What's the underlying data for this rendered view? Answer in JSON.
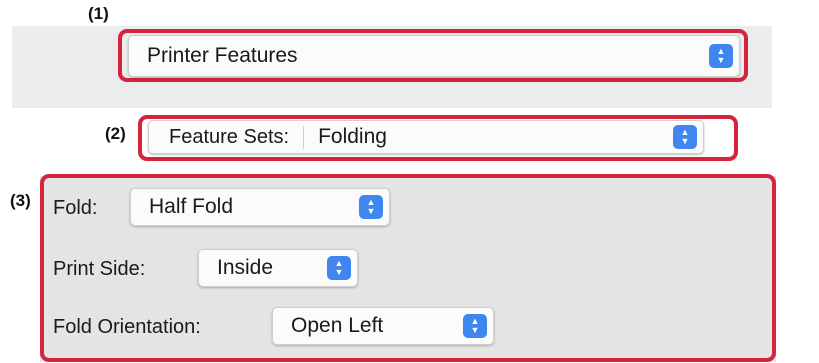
{
  "callouts": {
    "c1": "(1)",
    "c2": "(2)",
    "c3": "(3)"
  },
  "top_popup": {
    "value": "Printer Features",
    "icon": "up-down-chevron-icon"
  },
  "feature_sets": {
    "label": "Feature Sets:",
    "value": "Folding",
    "icon": "up-down-chevron-icon"
  },
  "options": [
    {
      "label": "Fold:",
      "value": "Half Fold"
    },
    {
      "label": "Print Side:",
      "value": "Inside"
    },
    {
      "label": "Fold Orientation:",
      "value": "Open Left"
    }
  ],
  "colors": {
    "callout": "#d3253c",
    "stepper": "#3f86f0",
    "panel": "#e4e4e4"
  }
}
